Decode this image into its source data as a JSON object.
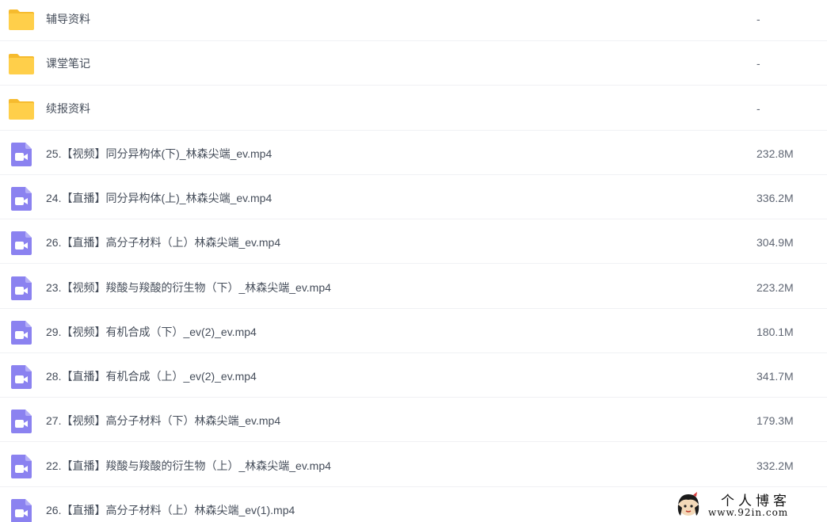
{
  "files": [
    {
      "type": "folder",
      "name": "辅导资料",
      "size": "-"
    },
    {
      "type": "folder",
      "name": "课堂笔记",
      "size": "-"
    },
    {
      "type": "folder",
      "name": "续报资料",
      "size": "-"
    },
    {
      "type": "video",
      "name": "25.【视频】同分异构体(下)_林森尖端_ev.mp4",
      "size": "232.8M"
    },
    {
      "type": "video",
      "name": "24.【直播】同分异构体(上)_林森尖端_ev.mp4",
      "size": "336.2M"
    },
    {
      "type": "video",
      "name": "26.【直播】高分子材料（上）林森尖端_ev.mp4",
      "size": "304.9M"
    },
    {
      "type": "video",
      "name": "23.【视频】羧酸与羧酸的衍生物（下）_林森尖端_ev.mp4",
      "size": "223.2M"
    },
    {
      "type": "video",
      "name": "29.【视频】有机合成（下）_ev(2)_ev.mp4",
      "size": "180.1M"
    },
    {
      "type": "video",
      "name": "28.【直播】有机合成（上）_ev(2)_ev.mp4",
      "size": "341.7M"
    },
    {
      "type": "video",
      "name": "27.【视频】高分子材料（下）林森尖端_ev.mp4",
      "size": "179.3M"
    },
    {
      "type": "video",
      "name": "22.【直播】羧酸与羧酸的衍生物（上）_林森尖端_ev.mp4",
      "size": "332.2M"
    },
    {
      "type": "video",
      "name": "26.【直播】高分子材料（上）林森尖端_ev(1).mp4",
      "size": ""
    }
  ],
  "watermark": {
    "title": "个人博客",
    "url": "www.92in.com"
  },
  "colors": {
    "folder": "#ffcf4a",
    "folder_tab": "#f6bb2e",
    "video": "#8b82f0",
    "row_divider": "#f0f1f4",
    "text": "#454d5a"
  }
}
